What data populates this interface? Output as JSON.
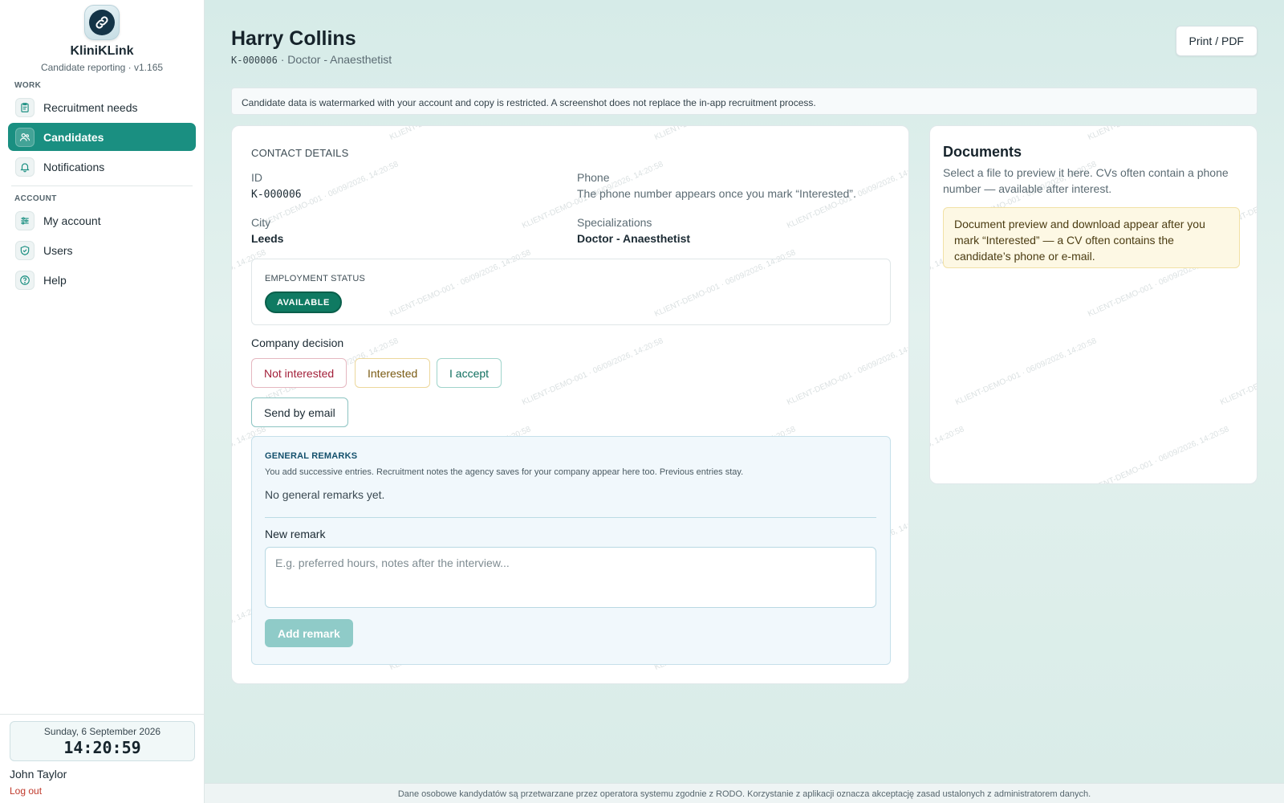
{
  "brand": {
    "name": "KliniKLink",
    "subtitle": "Candidate reporting · v1.165"
  },
  "sidebar": {
    "work_label": "WORK",
    "account_label": "ACCOUNT",
    "work_items": [
      {
        "label": "Recruitment needs",
        "icon": "clipboard-icon"
      },
      {
        "label": "Candidates",
        "icon": "users-icon",
        "active": true
      },
      {
        "label": "Notifications",
        "icon": "bell-icon"
      }
    ],
    "account_items": [
      {
        "label": "My account",
        "icon": "sliders-icon"
      },
      {
        "label": "Users",
        "icon": "shield-icon"
      },
      {
        "label": "Help",
        "icon": "help-icon"
      }
    ],
    "date": "Sunday, 6 September 2026",
    "time": "14:20:59",
    "user": "John Taylor",
    "logout": "Log out"
  },
  "header": {
    "name": "Harry Collins",
    "id": "K-000006",
    "role": "· Doctor - Anaesthetist",
    "print_label": "Print / PDF"
  },
  "notice": "Candidate data is watermarked with your account and copy is restricted. A screenshot does not replace the in-app recruitment process.",
  "watermark": "KLIENT-DEMO-001 · 06/09/2026, 14:20:58",
  "contact": {
    "section": "CONTACT DETAILS",
    "id_label": "ID",
    "id_value": "K-000006",
    "phone_label": "Phone",
    "phone_value": "The phone number appears once you mark “Interested”.",
    "city_label": "City",
    "city_value": "Leeds",
    "spec_label": "Specializations",
    "spec_value": "Doctor - Anaesthetist",
    "status_label": "EMPLOYMENT STATUS",
    "status_value": "AVAILABLE",
    "decision_label": "Company decision",
    "btn_not": "Not interested",
    "btn_int": "Interested",
    "btn_acc": "I accept",
    "btn_mail": "Send by email"
  },
  "remarks": {
    "title": "GENERAL REMARKS",
    "desc": "You add successive entries. Recruitment notes the agency saves for your company appear here too. Previous entries stay.",
    "empty": "No general remarks yet.",
    "new_label": "New remark",
    "placeholder": "E.g. preferred hours, notes after the interview...",
    "add_label": "Add remark"
  },
  "documents": {
    "title": "Documents",
    "desc": "Select a file to preview it here. CVs often contain a phone number — available after interest.",
    "warning": "Document preview and download appear after you mark “Interested” — a CV often contains the candidate’s phone or e-mail."
  },
  "footer": "Dane osobowe kandydatów są przetwarzane przez operatora systemu zgodnie z RODO. Korzystanie z aplikacji oznacza akceptację zasad ustalonych z administratorem danych.",
  "colors": {
    "accent": "#1a8f81",
    "status": "#0f7a62"
  }
}
